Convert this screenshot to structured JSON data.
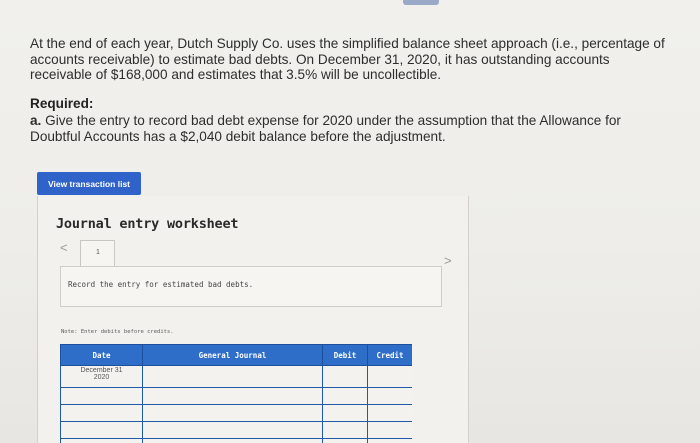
{
  "problem": {
    "text": "At the end of each year, Dutch Supply Co. uses the simplified balance sheet approach (i.e., percentage of accounts receivable) to estimate bad debts. On December 31, 2020, it has outstanding accounts receivable of $168,000 and estimates that 3.5% will be uncollectible."
  },
  "required": {
    "title": "Required:",
    "a_letter": "a.",
    "a_text": "Give the entry to record bad debt expense for 2020 under the assumption that the Allowance for Doubtful Accounts has a $2,040 debit balance before the adjustment."
  },
  "view_button_label": "View transaction list",
  "worksheet": {
    "title": "Journal entry worksheet",
    "prev_symbol": "<",
    "next_symbol": ">",
    "page_number": "1",
    "instruction": "Record the entry for estimated bad debts.",
    "note": "Note: Enter debits before credits.",
    "columns": [
      "Date",
      "General Journal",
      "Debit",
      "Credit"
    ],
    "date_line1": "December 31",
    "date_line2": "2020"
  },
  "colors": {
    "accent_blue": "#2f63c9",
    "table_header": "#2e6ec9"
  }
}
